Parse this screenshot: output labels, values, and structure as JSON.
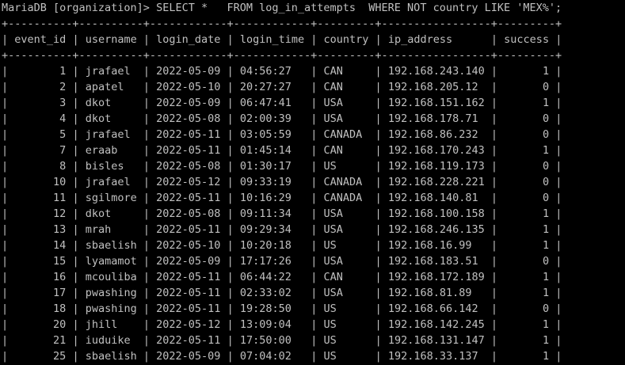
{
  "terminal": {
    "prompt": "MariaDB [organization]> ",
    "command": "SELECT *   FROM log_in_attempts  WHERE NOT country LIKE 'MEX%';"
  },
  "table": {
    "columns": [
      "event_id",
      "username",
      "login_date",
      "login_time",
      "country",
      "ip_address",
      "success"
    ],
    "rows": [
      [
        "1",
        "jrafael",
        "2022-05-09",
        "04:56:27",
        "CAN",
        "192.168.243.140",
        "1"
      ],
      [
        "2",
        "apatel",
        "2022-05-10",
        "20:27:27",
        "CAN",
        "192.168.205.12",
        "0"
      ],
      [
        "3",
        "dkot",
        "2022-05-09",
        "06:47:41",
        "USA",
        "192.168.151.162",
        "1"
      ],
      [
        "4",
        "dkot",
        "2022-05-08",
        "02:00:39",
        "USA",
        "192.168.178.71",
        "0"
      ],
      [
        "5",
        "jrafael",
        "2022-05-11",
        "03:05:59",
        "CANADA",
        "192.168.86.232",
        "0"
      ],
      [
        "7",
        "eraab",
        "2022-05-11",
        "01:45:14",
        "CAN",
        "192.168.170.243",
        "1"
      ],
      [
        "8",
        "bisles",
        "2022-05-08",
        "01:30:17",
        "US",
        "192.168.119.173",
        "0"
      ],
      [
        "10",
        "jrafael",
        "2022-05-12",
        "09:33:19",
        "CANADA",
        "192.168.228.221",
        "0"
      ],
      [
        "11",
        "sgilmore",
        "2022-05-11",
        "10:16:29",
        "CANADA",
        "192.168.140.81",
        "0"
      ],
      [
        "12",
        "dkot",
        "2022-05-08",
        "09:11:34",
        "USA",
        "192.168.100.158",
        "1"
      ],
      [
        "13",
        "mrah",
        "2022-05-11",
        "09:29:34",
        "USA",
        "192.168.246.135",
        "1"
      ],
      [
        "14",
        "sbaelish",
        "2022-05-10",
        "10:20:18",
        "US",
        "192.168.16.99",
        "1"
      ],
      [
        "15",
        "lyamamot",
        "2022-05-09",
        "17:17:26",
        "USA",
        "192.168.183.51",
        "0"
      ],
      [
        "16",
        "mcouliba",
        "2022-05-11",
        "06:44:22",
        "CAN",
        "192.168.172.189",
        "1"
      ],
      [
        "17",
        "pwashing",
        "2022-05-11",
        "02:33:02",
        "USA",
        "192.168.81.89",
        "1"
      ],
      [
        "18",
        "pwashing",
        "2022-05-11",
        "19:28:50",
        "US",
        "192.168.66.142",
        "0"
      ],
      [
        "20",
        "jhill",
        "2022-05-12",
        "13:09:04",
        "US",
        "192.168.142.245",
        "1"
      ],
      [
        "21",
        "iuduike",
        "2022-05-11",
        "17:50:00",
        "US",
        "192.168.131.147",
        "1"
      ],
      [
        "25",
        "sbaelish",
        "2022-05-09",
        "07:04:02",
        "US",
        "192.168.33.137",
        "1"
      ]
    ]
  }
}
